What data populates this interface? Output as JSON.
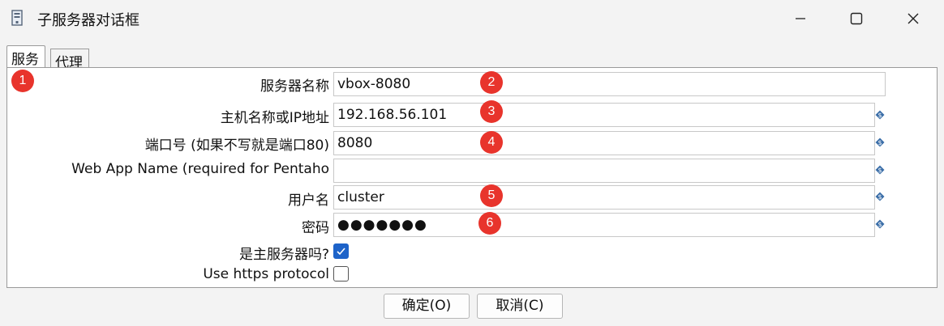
{
  "window": {
    "title": "子服务器对话框",
    "app_icon": "server-icon",
    "controls": [
      "minimize-icon",
      "maximize-icon",
      "close-icon"
    ]
  },
  "tabs": [
    {
      "label": "服务",
      "active": true
    },
    {
      "label": "代理",
      "active": false
    }
  ],
  "form": {
    "server_name": {
      "label": "服务器名称",
      "value": "vbox-8080"
    },
    "hostname": {
      "label": "主机名称或IP地址",
      "value": "192.168.56.101"
    },
    "port": {
      "label": "端口号 (如果不写就是端口80)",
      "value": "8080"
    },
    "webapp": {
      "label": "Web App Name (required for Pentaho",
      "value": ""
    },
    "username": {
      "label": "用户名",
      "value": "cluster"
    },
    "password": {
      "label": "密码",
      "value": "●●●●●●●"
    },
    "is_master": {
      "label": "是主服务器吗?",
      "checked": true
    },
    "https": {
      "label": "Use https protocol",
      "checked": false
    }
  },
  "badges": [
    "1",
    "2",
    "3",
    "4",
    "5",
    "6"
  ],
  "buttons": {
    "ok": "确定(O)",
    "cancel": "取消(C)"
  },
  "colors": {
    "badge": "#e8342c",
    "checkbox_checked": "#1d63c9",
    "variable_icon": "#3b6ea8"
  }
}
